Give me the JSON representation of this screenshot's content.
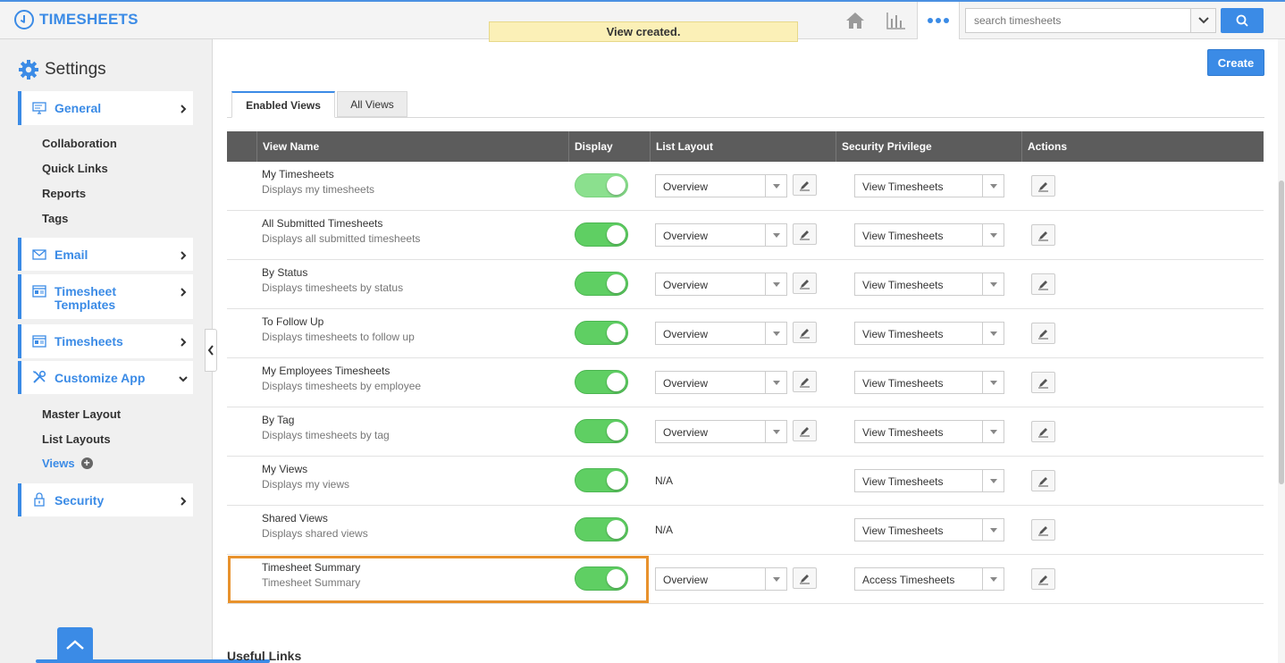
{
  "app": {
    "title": "TIMESHEETS"
  },
  "toast": {
    "message": "View created."
  },
  "header": {
    "icons": [
      "home-icon",
      "bar-chart-icon",
      "more-dots-icon",
      "search-icon"
    ],
    "search": {
      "placeholder": "search timesheets",
      "value": ""
    },
    "accent": "#3b8be6"
  },
  "sidebar": {
    "title": "Settings",
    "sections": [
      {
        "label": "General",
        "icon": "monitor-icon",
        "expanded": true,
        "children": [
          "Collaboration",
          "Quick Links",
          "Reports",
          "Tags"
        ]
      },
      {
        "label": "Email",
        "icon": "envelope-icon",
        "expanded": false,
        "children": []
      },
      {
        "label": "Timesheet Templates",
        "icon": "template-icon",
        "expanded": false,
        "children": []
      },
      {
        "label": "Timesheets",
        "icon": "timesheet-icon",
        "expanded": false,
        "children": []
      },
      {
        "label": "Customize App",
        "icon": "tools-icon",
        "expanded": true,
        "children": [
          "Master Layout",
          "List Layouts",
          "Views"
        ],
        "active_child": "Views"
      },
      {
        "label": "Security",
        "icon": "lock-icon",
        "expanded": false,
        "children": []
      }
    ]
  },
  "main": {
    "create_label": "Create",
    "tabs": [
      {
        "label": "Enabled Views",
        "active": true
      },
      {
        "label": "All Views",
        "active": false
      }
    ],
    "columns": [
      "View Name",
      "Display",
      "List Layout",
      "Security Privilege",
      "Actions"
    ],
    "rows": [
      {
        "name": "My Timesheets",
        "desc": "Displays my timesheets",
        "display": true,
        "layout": "Overview",
        "privilege": "View Timesheets"
      },
      {
        "name": "All Submitted Timesheets",
        "desc": "Displays all submitted timesheets",
        "display": true,
        "layout": "Overview",
        "privilege": "View Timesheets"
      },
      {
        "name": "By Status",
        "desc": "Displays timesheets by status",
        "display": true,
        "layout": "Overview",
        "privilege": "View Timesheets"
      },
      {
        "name": "To Follow Up",
        "desc": "Displays timesheets to follow up",
        "display": true,
        "layout": "Overview",
        "privilege": "View Timesheets"
      },
      {
        "name": "My Employees Timesheets",
        "desc": "Displays timesheets by employee",
        "display": true,
        "layout": "Overview",
        "privilege": "View Timesheets"
      },
      {
        "name": "By Tag",
        "desc": "Displays timesheets by tag",
        "display": true,
        "layout": "Overview",
        "privilege": "View Timesheets"
      },
      {
        "name": "My Views",
        "desc": "Displays my views",
        "display": true,
        "layout": "N/A",
        "privilege": "View Timesheets"
      },
      {
        "name": "Shared Views",
        "desc": "Displays shared views",
        "display": true,
        "layout": "N/A",
        "privilege": "View Timesheets"
      },
      {
        "name": "Timesheet Summary",
        "desc": "Timesheet Summary",
        "display": true,
        "layout": "Overview",
        "privilege": "Access Timesheets"
      }
    ],
    "useful_links_title": "Useful Links"
  }
}
